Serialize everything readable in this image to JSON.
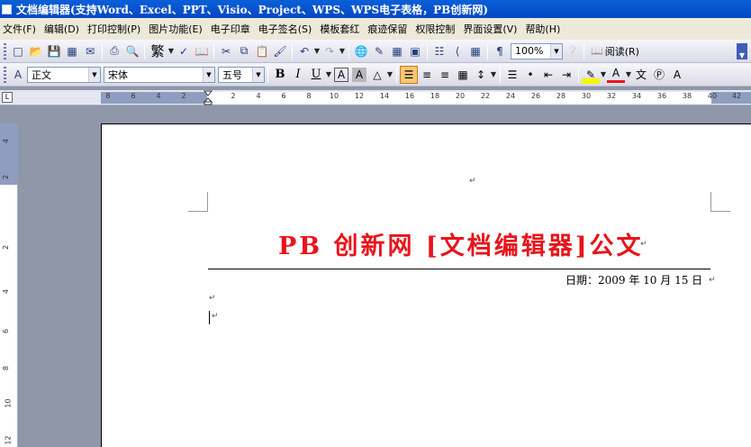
{
  "window": {
    "title": "文档编辑器(支持Word、Excel、PPT、Visio、Project、WPS、WPS电子表格，PB创新网)"
  },
  "menu": [
    {
      "label": "文件(F)"
    },
    {
      "label": "编辑(D)"
    },
    {
      "label": "打印控制(P)"
    },
    {
      "label": "图片功能(E)"
    },
    {
      "label": "电子印章"
    },
    {
      "label": "电子签名(S)"
    },
    {
      "label": "模板套红"
    },
    {
      "label": "痕迹保留"
    },
    {
      "label": "权限控制"
    },
    {
      "label": "界面设置(V)"
    },
    {
      "label": "帮助(H)"
    }
  ],
  "toolbar": {
    "zoom_value": "100%",
    "read_label": "阅读(R)",
    "traditional_label": "繁"
  },
  "format": {
    "style_value": "正文",
    "font_value": "宋体",
    "size_value": "五号",
    "bold_label": "B",
    "italic_label": "I",
    "underline_label": "U",
    "font_color": "#e8141b"
  },
  "ruler": {
    "numbers": [
      "8",
      "6",
      "4",
      "2",
      "2",
      "4",
      "6",
      "8",
      "10",
      "12",
      "14",
      "16",
      "18",
      "20",
      "22",
      "24",
      "26",
      "28",
      "30",
      "32",
      "34",
      "36",
      "38",
      "40",
      "42"
    ],
    "vertical_numbers": [
      "4",
      "2",
      "2",
      "4",
      "6",
      "8",
      "10",
      "12"
    ]
  },
  "document": {
    "title": "PB 创新网 [文档编辑器]公文",
    "date": "日期：2009 年 10 月 15 日",
    "title_color": "#e8141b"
  }
}
